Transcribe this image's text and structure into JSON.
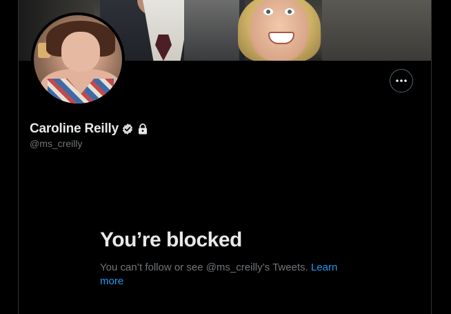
{
  "profile": {
    "display_name": "Caroline Reilly",
    "handle": "@ms_creilly",
    "verified_icon": "verified-badge-icon",
    "protected_icon": "lock-icon",
    "more_icon": "more-horizontal-icon"
  },
  "blocked": {
    "title": "You’re blocked",
    "message": "You can’t follow or see @ms_creilly’s Tweets.",
    "link_label": "Learn more"
  },
  "colors": {
    "background": "#000000",
    "text_primary": "#e7e9ea",
    "text_secondary": "#71767b",
    "link": "#1d9bf0",
    "border": "#2f3336"
  }
}
